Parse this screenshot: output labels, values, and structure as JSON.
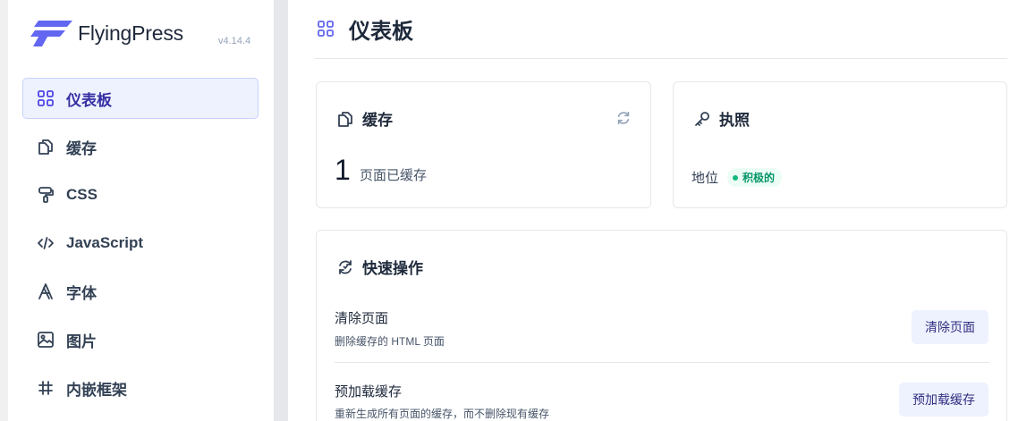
{
  "app": {
    "name": "FlyingPress",
    "version": "v4.14.4",
    "brand_color": "#6366f1"
  },
  "sidebar": {
    "items": [
      {
        "label": "仪表板",
        "icon": "grid-icon",
        "active": true
      },
      {
        "label": "缓存",
        "icon": "copy-icon",
        "active": false
      },
      {
        "label": "CSS",
        "icon": "paint-roller-icon",
        "active": false
      },
      {
        "label": "JavaScript",
        "icon": "code-icon",
        "active": false
      },
      {
        "label": "字体",
        "icon": "font-icon",
        "active": false
      },
      {
        "label": "图片",
        "icon": "image-icon",
        "active": false
      },
      {
        "label": "内嵌框架",
        "icon": "hash-icon",
        "active": false
      }
    ]
  },
  "page": {
    "title": "仪表板",
    "icon": "grid-icon"
  },
  "cache_card": {
    "title": "缓存",
    "count": "1",
    "count_label": "页面已缓存"
  },
  "license_card": {
    "title": "执照",
    "status_label": "地位",
    "status_value": "积极的",
    "status_color": "#059669"
  },
  "quick_actions": {
    "title": "快速操作",
    "items": [
      {
        "title": "清除页面",
        "description": "删除缓存的 HTML 页面",
        "button": "清除页面"
      },
      {
        "title": "预加载缓存",
        "description": "重新生成所有页面的缓存，而不删除现有缓存",
        "button": "预加载缓存"
      }
    ]
  }
}
